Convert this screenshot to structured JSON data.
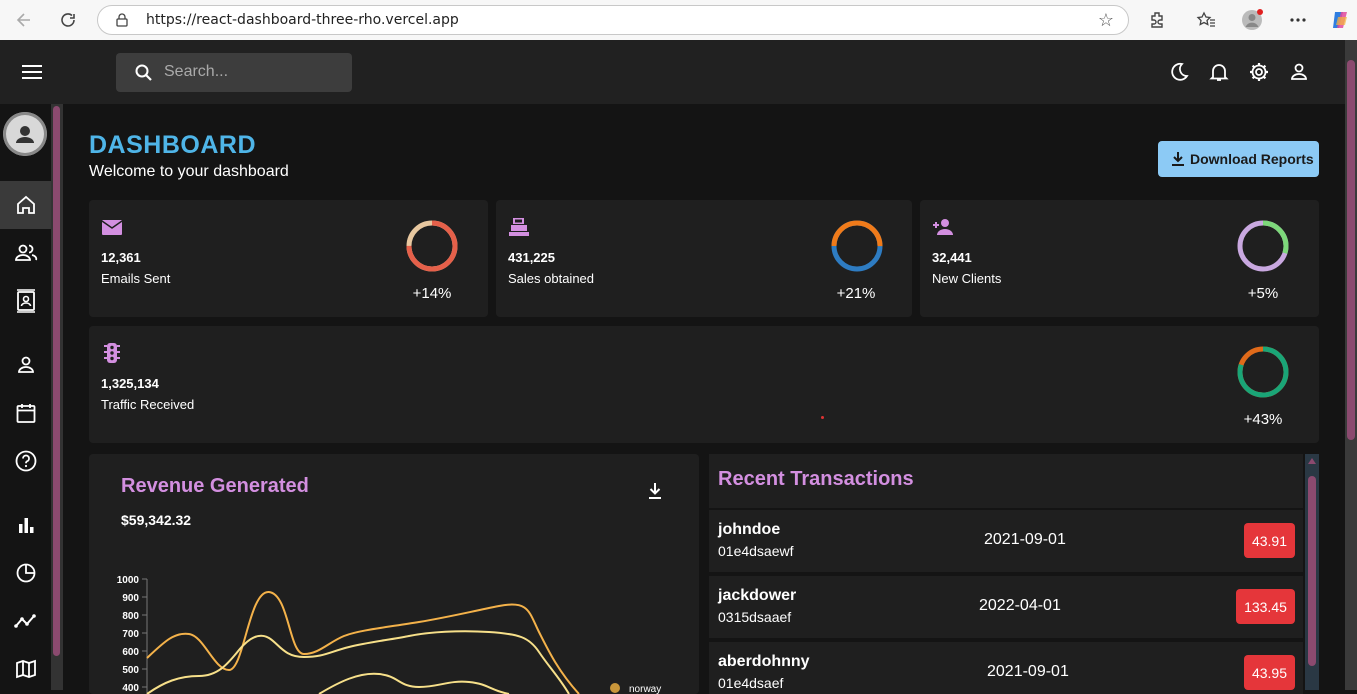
{
  "browser": {
    "url": "https://react-dashboard-three-rho.vercel.app"
  },
  "topbar": {
    "search_placeholder": "Search..."
  },
  "header": {
    "title": "DASHBOARD",
    "subtitle": "Welcome to your dashboard",
    "download_label": "Download Reports"
  },
  "stats": [
    {
      "value": "12,361",
      "label": "Emails Sent",
      "change": "+14%",
      "progress": 0.75,
      "icon": "email-icon"
    },
    {
      "value": "431,225",
      "label": "Sales obtained",
      "change": "+21%",
      "progress": 0.5,
      "icon": "point-of-sale-icon"
    },
    {
      "value": "32,441",
      "label": "New Clients",
      "change": "+5%",
      "progress": 0.3,
      "icon": "person-add-icon"
    },
    {
      "value": "1,325,134",
      "label": "Traffic Received",
      "change": "+43%",
      "progress": 0.8,
      "icon": "traffic-icon"
    }
  ],
  "revenue": {
    "title": "Revenue Generated",
    "amount": "$59,342.32",
    "y_ticks": [
      "1000",
      "900",
      "800",
      "700",
      "600",
      "500",
      "400"
    ],
    "legend_partial": "norway"
  },
  "transactions": {
    "title": "Recent Transactions",
    "rows": [
      {
        "user": "johndoe",
        "txId": "01e4dsaewf",
        "date": "2021-09-01",
        "cost": "43.91"
      },
      {
        "user": "jackdower",
        "txId": "0315dsaaef",
        "date": "2022-04-01",
        "cost": "133.45"
      },
      {
        "user": "aberdohnny",
        "txId": "01e4dsaef",
        "date": "2021-09-01",
        "cost": "43.95"
      }
    ]
  },
  "colors": {
    "accent_blue": "#4fb5e8",
    "accent_purple": "#d38fe0",
    "cost_red": "#e5363a"
  }
}
